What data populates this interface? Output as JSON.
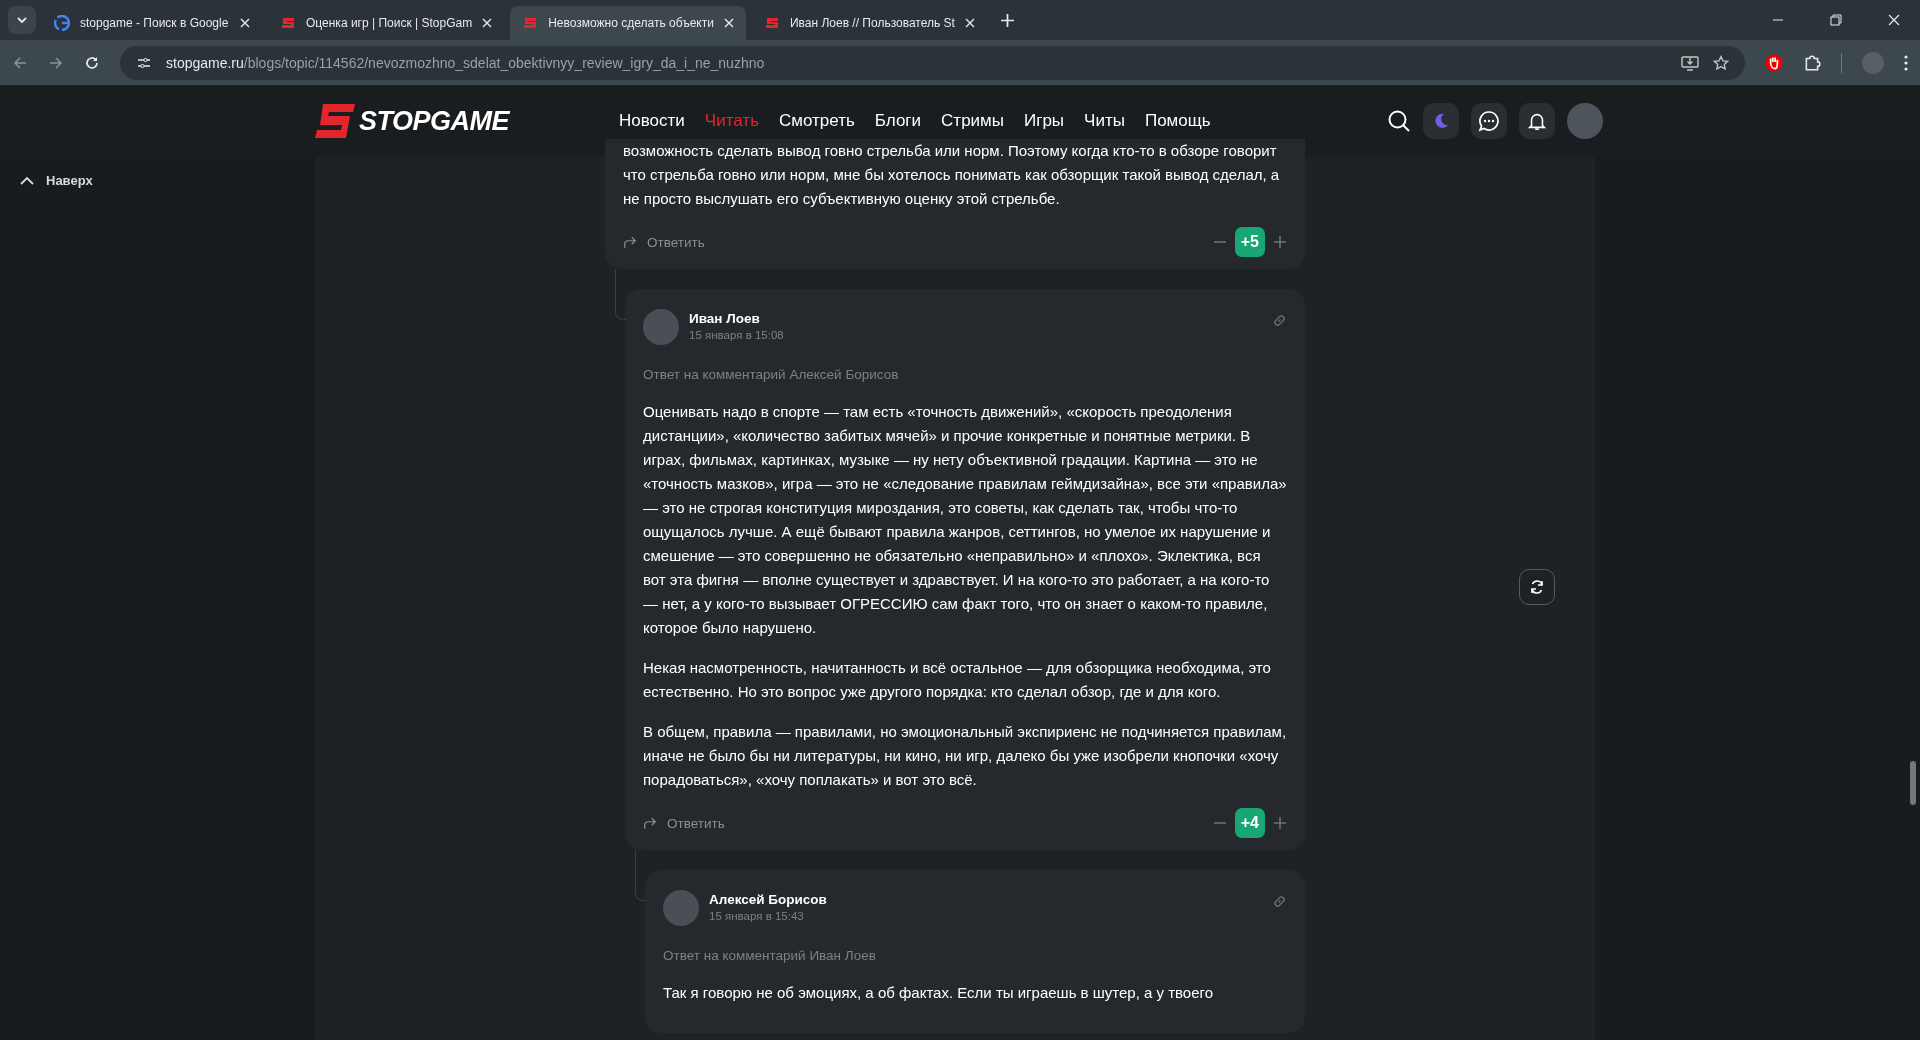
{
  "browser": {
    "tabs": [
      {
        "title": "stopgame - Поиск в Google",
        "kind": "google",
        "selected": false
      },
      {
        "title": "Оценка игр | Поиск | StopGam",
        "kind": "site",
        "selected": false
      },
      {
        "title": "Невозможно сделать объекти",
        "kind": "site",
        "selected": true
      },
      {
        "title": "Иван Лоев // Пользователь St",
        "kind": "site",
        "selected": false
      }
    ],
    "address": {
      "domain": "stopgame.ru",
      "path": "/blogs/topic/114562/nevozmozhno_sdelat_obektivnyy_review_igry_da_i_ne_nuzhno"
    }
  },
  "site": {
    "logo": "STOPGAME",
    "nav": [
      {
        "label": "Новости",
        "selected": false
      },
      {
        "label": "Читать",
        "selected": true
      },
      {
        "label": "Смотреть",
        "selected": false
      },
      {
        "label": "Блоги",
        "selected": false
      },
      {
        "label": "Стримы",
        "selected": false
      },
      {
        "label": "Игры",
        "selected": false
      },
      {
        "label": "Читы",
        "selected": false
      },
      {
        "label": "Помощь",
        "selected": false
      }
    ]
  },
  "sidebar": {
    "back_to_top": "Наверх"
  },
  "comments": [
    {
      "paragraphs": [
        "возможность сделать вывод говно стрельба или норм. Поэтому когда кто-то в обзоре говорит что стрельба говно или норм, мне бы хотелось понимать как обзорщик такой вывод сделал, а не просто выслушать его субъективную оценку этой стрельбе."
      ],
      "reply_label": "Ответить",
      "score": "+5",
      "children": [
        {
          "author": "Иван Лоев",
          "date": "15 января в 15:08",
          "reply_to": "Ответ на комментарий Алексей Борисов",
          "paragraphs": [
            "Оценивать надо в спорте — там есть «точность движений», «скорость преодоления дистанции», «количество забитых мячей» и прочие конкретные и понятные метрики. В играх, фильмах, картинках, музыке — ну нету объективной градации. Картина — это не «точность мазков», игра — это не «следование правилам геймдизайна», все эти «правила» — это не строгая конституция мироздания, это советы, как сделать так, чтобы что-то ощущалось лучше. А ещё бывают правила жанров, сеттингов, но умелое их нарушение и смешение — это совершенно не обязательно «неправильно» и «плохо». Эклектика, вся вот эта фигня — вполне существует и здравствует. И на кого-то это работает, а на кого-то — нет, а у кого-то вызывает ОГРЕССИЮ сам факт того, что он знает о каком-то правиле, которое было нарушено.",
            "Некая насмотренность, начитанность и всё остальное — для обзорщика необходима, это естественно. Но это вопрос уже другого порядка: кто сделал обзор, где и для кого.",
            "В общем, правила — правилами, но эмоциональный экспириенс не подчиняется правилам, иначе не было бы ни литературы, ни кино, ни игр, далеко бы уже изобрели кнопочки «хочу порадоваться», «хочу поплакать» и вот это всё."
          ],
          "reply_label": "Ответить",
          "score": "+4",
          "children": [
            {
              "author": "Алексей Борисов",
              "date": "15 января в 15:43",
              "reply_to": "Ответ на комментарий Иван Лоев",
              "paragraphs": [
                "Так я говорю не об эмоциях, а об фактах. Если ты играешь в шутер, а у твоего"
              ]
            }
          ]
        }
      ]
    }
  ]
}
